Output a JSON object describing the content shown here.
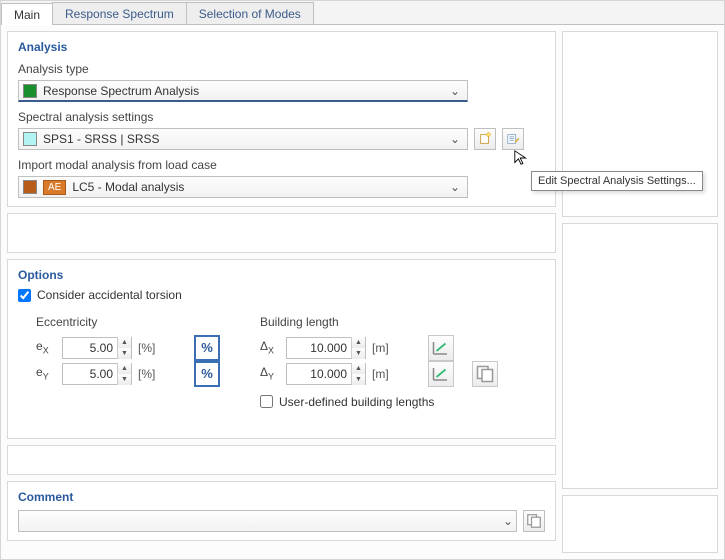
{
  "tabs": {
    "main": "Main",
    "rs": "Response Spectrum",
    "modes": "Selection of Modes"
  },
  "analysis": {
    "title": "Analysis",
    "type_label": "Analysis type",
    "type_value": "Response Spectrum Analysis",
    "spectral_label": "Spectral analysis settings",
    "spectral_value": "SPS1 - SRSS | SRSS",
    "import_label": "Import modal analysis from load case",
    "import_badge": "AE",
    "import_value": "LC5 - Modal analysis"
  },
  "options": {
    "title": "Options",
    "accidental_torsion": "Consider accidental torsion",
    "ecc_title": "Eccentricity",
    "ex_label": "eX",
    "ey_label": "eY",
    "ex_value": "5.00",
    "ey_value": "5.00",
    "ex_unit": "[%]",
    "ey_unit": "[%]",
    "bl_title": "Building length",
    "dx_label": "ΔX",
    "dy_label": "ΔY",
    "dx_value": "10.000",
    "dy_value": "10.000",
    "dx_unit": "[m]",
    "dy_unit": "[m]",
    "userdef_label": "User-defined building lengths"
  },
  "comment": {
    "title": "Comment",
    "value": ""
  },
  "tooltip": "Edit Spectral Analysis Settings...",
  "icons": {
    "new": "new-icon",
    "edit": "edit-icon",
    "percent": "%",
    "chevron": "⌄"
  }
}
